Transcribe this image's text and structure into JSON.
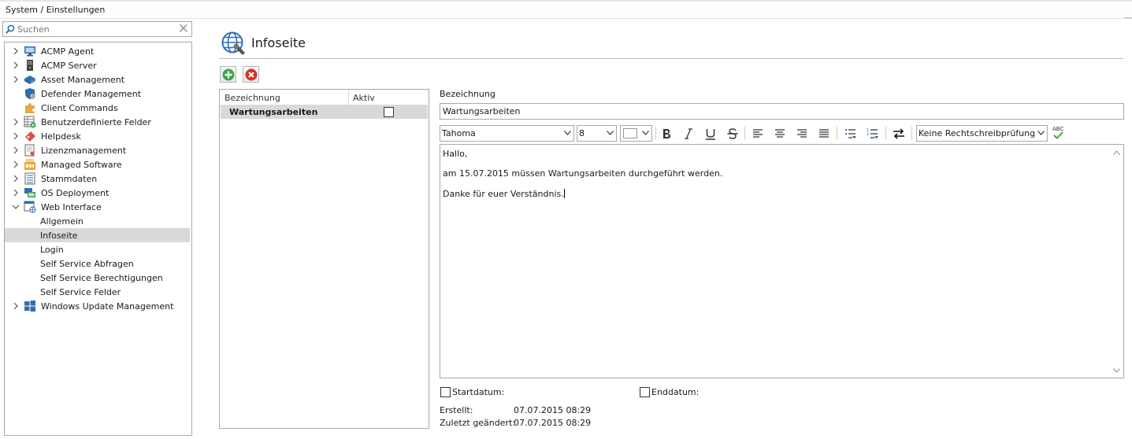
{
  "window": {
    "breadcrumb": "System / Einstellungen"
  },
  "search": {
    "placeholder": "Suchen"
  },
  "tree": [
    {
      "label": "ACMP Agent",
      "icon": "monitor-icon",
      "expand": "collapsed"
    },
    {
      "label": "ACMP Server",
      "icon": "server-icon",
      "expand": "collapsed"
    },
    {
      "label": "Asset Management",
      "icon": "asset-box-icon",
      "expand": "collapsed"
    },
    {
      "label": "Defender Management",
      "icon": "shield-icon",
      "expand": "none"
    },
    {
      "label": "Client Commands",
      "icon": "puzzle-icon",
      "expand": "none"
    },
    {
      "label": "Benutzerdefinierte Felder",
      "icon": "custom-fields-icon",
      "expand": "collapsed"
    },
    {
      "label": "Helpdesk",
      "icon": "ticket-icon",
      "expand": "collapsed"
    },
    {
      "label": "Lizenzmanagement",
      "icon": "license-icon",
      "expand": "collapsed"
    },
    {
      "label": "Managed Software",
      "icon": "software-icon",
      "expand": "collapsed"
    },
    {
      "label": "Stammdaten",
      "icon": "master-data-icon",
      "expand": "collapsed"
    },
    {
      "label": "OS Deployment",
      "icon": "os-deployment-icon",
      "expand": "collapsed"
    },
    {
      "label": "Web Interface",
      "icon": "web-interface-icon",
      "expand": "expanded"
    },
    {
      "label": "Allgemein",
      "child": true
    },
    {
      "label": "Infoseite",
      "child": true,
      "selected": true
    },
    {
      "label": "Login",
      "child": true
    },
    {
      "label": "Self Service Abfragen",
      "child": true
    },
    {
      "label": "Self Service Berechtigungen",
      "child": true
    },
    {
      "label": "Self Service Felder",
      "child": true
    },
    {
      "label": "Windows Update Management",
      "icon": "windows-icon",
      "expand": "collapsed"
    }
  ],
  "page": {
    "title": "Infoseite"
  },
  "list": {
    "col_name": "Bezeichnung",
    "col_active": "Aktiv",
    "rows": [
      {
        "name": "Wartungsarbeiten",
        "active": false
      }
    ]
  },
  "editor": {
    "name_label": "Bezeichnung",
    "name_value": "Wartungsarbeiten",
    "font": "Tahoma",
    "size": "8",
    "spellcheck": "Keine Rechtschreibprüfung",
    "spell_icon_text": "ABC",
    "lines": [
      "Hallo,",
      "am 15.07.2015 müssen Wartungsarbeiten durchgeführt werden.",
      "Danke für euer Verständnis."
    ]
  },
  "footer": {
    "start_label": "Startdatum:",
    "end_label": "Enddatum:",
    "created_label": "Erstellt:",
    "created_value": "07.07.2015 08:29",
    "modified_label": "Zuletzt geändert:",
    "modified_value": "07.07.2015 08:29"
  },
  "colors": {
    "selection": "#d9d9d9",
    "add_green": "#3aa64a",
    "delete_red": "#d93025",
    "accent_blue": "#2f6db5"
  }
}
